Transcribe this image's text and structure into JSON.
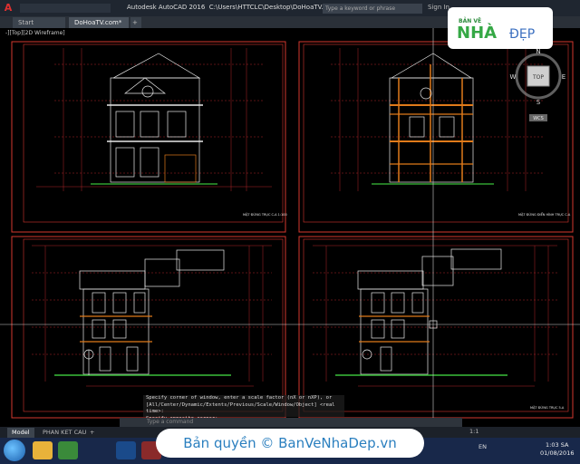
{
  "titlebar": {
    "app_title": "Autodesk AutoCAD 2016",
    "file_path": "C:\\Users\\HTTCLC\\Desktop\\DoHoaTV.com.dwg",
    "search_placeholder": "Type a keyword or phrase",
    "sign_in": "Sign In"
  },
  "doc_tabs": [
    {
      "label": "Start"
    },
    {
      "label": "DoHoaTV.com*"
    },
    {
      "label": "+"
    }
  ],
  "viewport": {
    "label": "-][Top][2D Wireframe]"
  },
  "viewcube": {
    "north": "N",
    "south": "S",
    "east": "E",
    "west": "W",
    "face": "TOP",
    "wcs": "WCS"
  },
  "drawings": [
    {
      "title": "MẶT ĐỨNG TRỤC C-A 1:100"
    },
    {
      "title": "MẶT ĐỨNG ĐIỂN HÌNH TRỤC C-A"
    },
    {
      "title": ""
    },
    {
      "title": "MẶT ĐỨNG TRỤC 5-A"
    }
  ],
  "command": {
    "history": [
      "Specify corner of window, enter a scale factor (nX or nXP), or",
      "[All/Center/Dynamic/Extents/Previous/Scale/Window/Object] <real time>:",
      "Specify opposite corner:"
    ],
    "placeholder": "Type a command"
  },
  "layout_tabs": [
    {
      "label": "Model"
    },
    {
      "label": "PHAN KET CAU"
    },
    {
      "label": "+"
    }
  ],
  "status": {
    "scale": "1:1"
  },
  "taskbar": {
    "language": "EN",
    "time": "1:03 SA",
    "date": "01/08/2016"
  },
  "watermark": {
    "text": "Bản quyền © BanVeNhaDep.vn",
    "logo_top": "BẢN VẼ",
    "logo_main": "NHÀ",
    "logo_sub": "ĐẸP"
  },
  "colors": {
    "frame": "#d4382e",
    "grid": "#b0242b",
    "hatch": "#e07a1a",
    "ink": "#e8e8e8",
    "ground": "#3bbf3b"
  }
}
